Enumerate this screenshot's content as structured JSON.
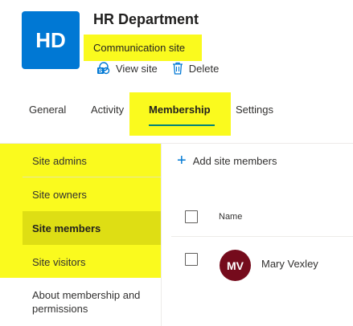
{
  "site": {
    "initials": "HD",
    "title": "HR Department",
    "type": "Communication site",
    "actions": {
      "view_site": "View site",
      "delete": "Delete"
    }
  },
  "tabs": [
    {
      "label": "General",
      "active": false
    },
    {
      "label": "Activity",
      "active": false
    },
    {
      "label": "Membership",
      "active": true
    },
    {
      "label": "Settings",
      "active": false
    }
  ],
  "leftnav": {
    "items": [
      {
        "label": "Site admins",
        "active": false
      },
      {
        "label": "Site owners",
        "active": false
      },
      {
        "label": "Site members",
        "active": true
      },
      {
        "label": "Site visitors",
        "active": false
      }
    ],
    "about": "About membership and permissions"
  },
  "members": {
    "add_label": "Add site members",
    "column_name": "Name",
    "rows": [
      {
        "initials": "MV",
        "name": "Mary Vexley",
        "avatar_color": "#750b1c"
      }
    ]
  },
  "colors": {
    "brand": "#0078d4",
    "tab_underline": "#00827a",
    "highlight": "#fafa1e"
  }
}
